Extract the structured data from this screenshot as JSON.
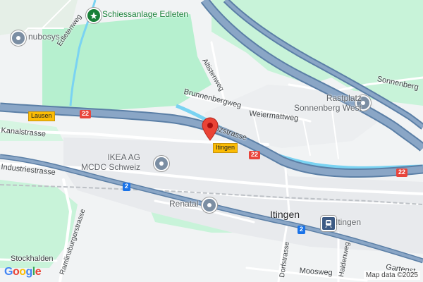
{
  "map": {
    "places": {
      "schiessanlage": "Schiessanlage Edleten",
      "nubosys": "nubosys",
      "ikea": "IKEA AG\nMCDC Schweiz",
      "renatal": "Renatal",
      "rastplatz": "Rastplatz\nSonnenberg West",
      "itingen_station": "Itingen"
    },
    "town": "Itingen",
    "streets": {
      "edletenweg": "Edletenweg",
      "kanalstrasse": "Kanalstrasse",
      "industriestrasse": "Industriestrasse",
      "ramlinsburgerstrasse": "Ramlinsburgerstrasse",
      "stockhalden": "Stockhalden",
      "brunnenbergweg": "Brunnenbergweg",
      "weiermattweg": "Weiermattweg",
      "altistenweg": "Altistenweg",
      "sonnenberg": "Sonnenberg",
      "zstrasse": "lzstrasse",
      "dorfstrasse": "Dorfstrasse",
      "moosweg": "Moosweg",
      "haldenweg": "Haldenweg",
      "gartenst": "Gartenst"
    },
    "shields": {
      "a22_left": "22",
      "a22_mid": "22",
      "a22_right": "22",
      "r2_left": "2",
      "r2_right": "2",
      "exit_lausen": "Lausen",
      "exit_itingen": "Itingen"
    },
    "marker": {
      "color": "#ea4335"
    },
    "colors": {
      "water": "#7ad3f2",
      "park": "#b6f0cf",
      "highway": "#7e99b8",
      "road": "#ffffff"
    },
    "logo": "Google",
    "attribution": "Map data ©2025"
  }
}
